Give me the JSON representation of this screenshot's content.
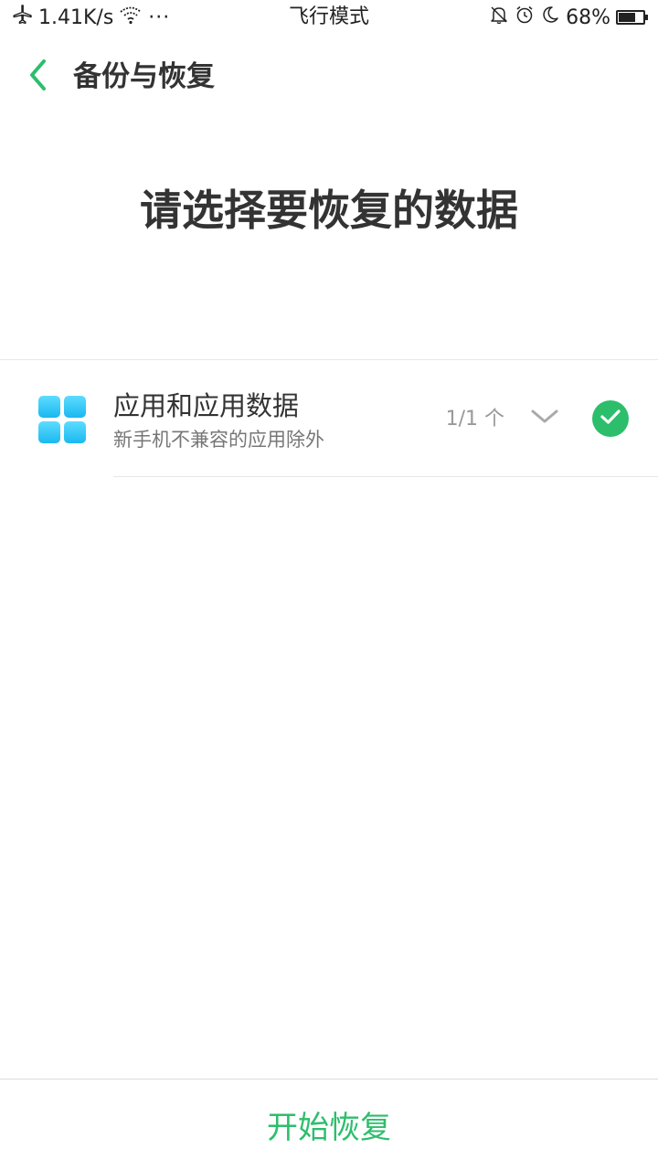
{
  "status_bar": {
    "network_speed": "1.41K/s",
    "more": "···",
    "mode_label": "飞行模式",
    "battery_percent": "68%",
    "battery_level": 0.68,
    "icons": [
      "airplane-icon",
      "wifi-icon",
      "mute-icon",
      "alarm-icon",
      "moon-icon",
      "battery-icon"
    ]
  },
  "header": {
    "title": "备份与恢复",
    "back_icon": "chevron-left-icon"
  },
  "main": {
    "heading": "请选择要恢复的数据",
    "items": [
      {
        "title": "应用和应用数据",
        "subtitle": "新手机不兼容的应用除外",
        "count": "1/1 个",
        "icon": "apps-grid-icon",
        "selected": true
      }
    ]
  },
  "footer": {
    "start_label": "开始恢复"
  },
  "colors": {
    "accent": "#2dbe6c",
    "text_primary": "#333333",
    "text_secondary": "#777777",
    "text_tertiary": "#999999",
    "icon_blue": "#29c6f5"
  }
}
